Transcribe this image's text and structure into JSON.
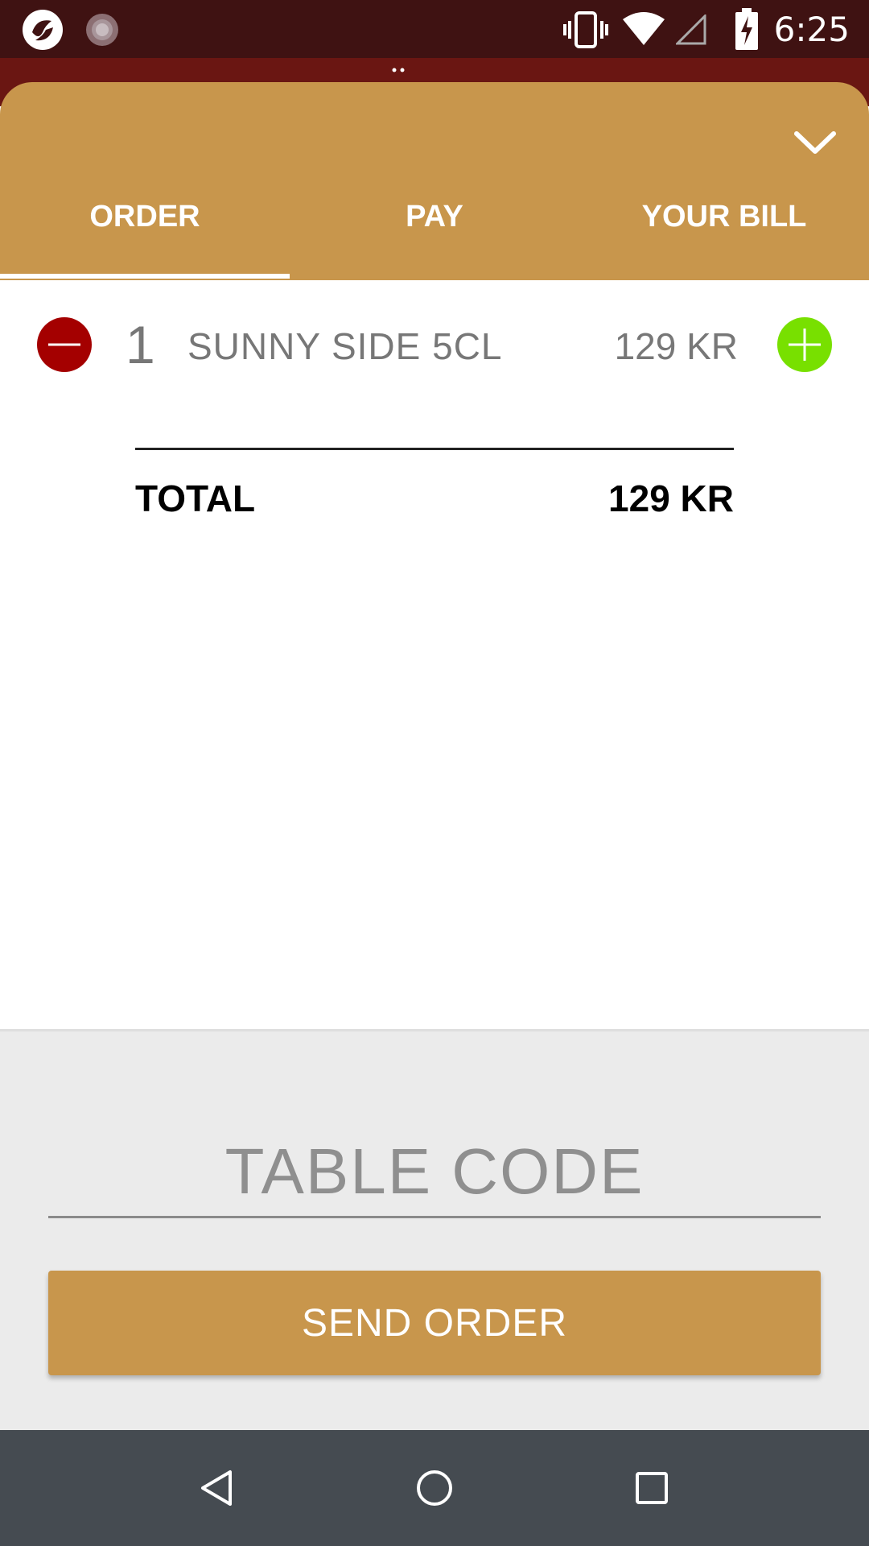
{
  "status_bar": {
    "time": "6:25",
    "icons": [
      "app-logo-icon",
      "loading-icon",
      "vibrate-icon",
      "wifi-icon",
      "cell-signal-icon",
      "battery-charging-icon"
    ]
  },
  "tabs": [
    {
      "label": "ORDER",
      "selected": true
    },
    {
      "label": "PAY",
      "selected": false
    },
    {
      "label": "YOUR BILL",
      "selected": false
    }
  ],
  "order": {
    "items": [
      {
        "quantity": "1",
        "name": "SUNNY SIDE 5CL",
        "price": "129 KR"
      }
    ],
    "total_label": "TOTAL",
    "total_value": "129 KR"
  },
  "table_code": {
    "placeholder": "TABLE CODE",
    "value": ""
  },
  "send_order_label": "SEND ORDER",
  "colors": {
    "status_bar": "#3f1212",
    "accent": "#c8964c",
    "minus": "#a40000",
    "plus": "#78e000",
    "nav_bar": "#454b51"
  }
}
